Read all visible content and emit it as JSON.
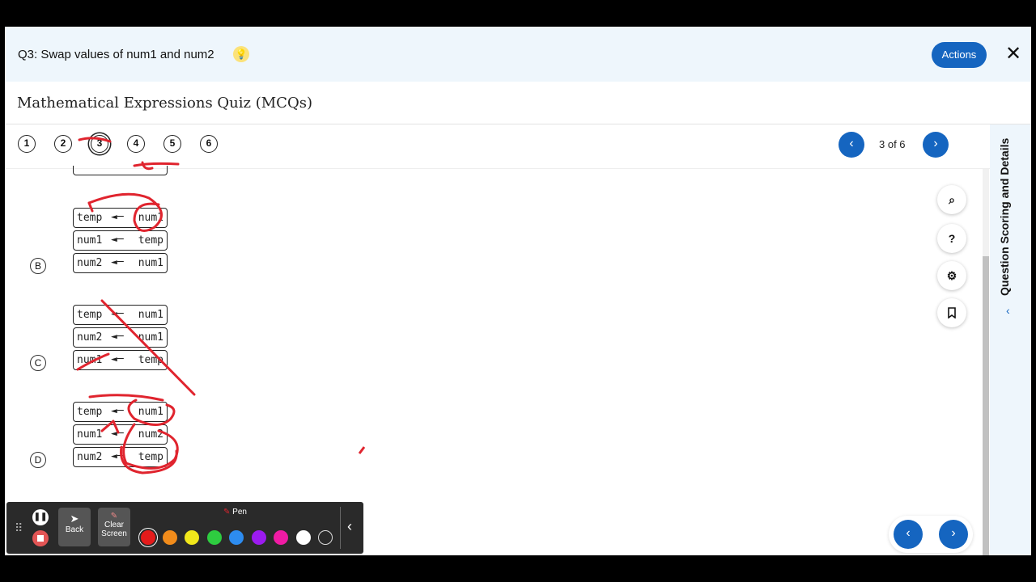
{
  "header": {
    "question_title": "Q3: Swap values of num1 and num2",
    "actions_label": "Actions",
    "close_label": "✕"
  },
  "quiz": {
    "title": "Mathematical Expressions Quiz (MCQs)",
    "questions": [
      "1",
      "2",
      "3",
      "4",
      "5",
      "6"
    ],
    "active_question": "3",
    "counter": "3 of 6"
  },
  "sidebar": {
    "label": "Question Scoring and Details"
  },
  "options": [
    {
      "label": "B",
      "rows": [
        [
          "temp",
          "num1"
        ],
        [
          "num1",
          "temp"
        ],
        [
          "num2",
          "num1"
        ]
      ]
    },
    {
      "label": "C",
      "rows": [
        [
          "temp",
          "num1"
        ],
        [
          "num2",
          "num1"
        ],
        [
          "num1",
          "temp"
        ]
      ]
    },
    {
      "label": "D",
      "rows": [
        [
          "temp",
          "num1"
        ],
        [
          "num1",
          "num2"
        ],
        [
          "num2",
          "temp"
        ]
      ]
    }
  ],
  "pen_toolbar": {
    "back_label": "Back",
    "clear_label": "Clear Screen",
    "pen_label": "Pen",
    "colors": [
      "#e41b1b",
      "#f28c1b",
      "#f1e71b",
      "#2ecc40",
      "#2d8cf0",
      "#9b1bf0",
      "#f01ba4",
      "#ffffff",
      "#2a2a2a"
    ]
  },
  "accent_color": "#1565c0",
  "annotation_color": "#e0242e"
}
